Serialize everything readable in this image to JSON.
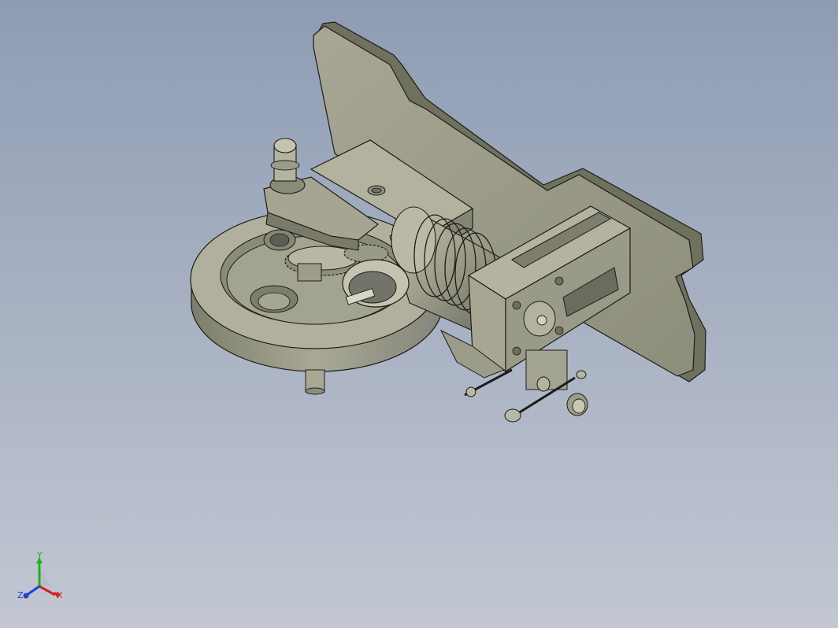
{
  "view": {
    "background_top": "#8e9cb3",
    "background_bottom": "#c2c7d2",
    "model_body_color": "#a3a391",
    "model_shadow_color": "#7c7c6c",
    "model_highlight_color": "#c9c9b7",
    "edge_color": "#1c1c18"
  },
  "model": {
    "parts": [
      "mounting-plate",
      "turntable-disc",
      "spur-gear",
      "clamp-lever",
      "finned-cylinder",
      "cylinder-head",
      "adjuster-screws"
    ]
  },
  "triad": {
    "x_label": "X",
    "y_label": "Y",
    "z_label": "Z",
    "x_color": "#d42020",
    "y_color": "#20b020",
    "z_color": "#2040d0"
  }
}
